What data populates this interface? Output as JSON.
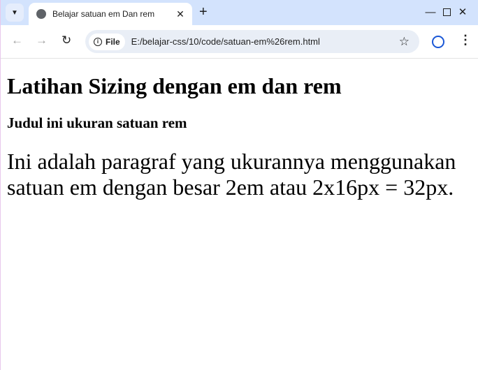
{
  "browser": {
    "tab_title": "Belajar satuan em Dan rem",
    "url_scheme_label": "File",
    "url": "E:/belajar-css/10/code/satuan-em%26rem.html",
    "accent": "#d3e3fd"
  },
  "page": {
    "h1": "Latihan Sizing dengan em dan rem",
    "h2": "Judul ini ukuran satuan rem",
    "paragraph": "Ini adalah paragraf yang ukurannya menggunakan satuan em dengan besar 2em atau 2x16px = 32px."
  }
}
